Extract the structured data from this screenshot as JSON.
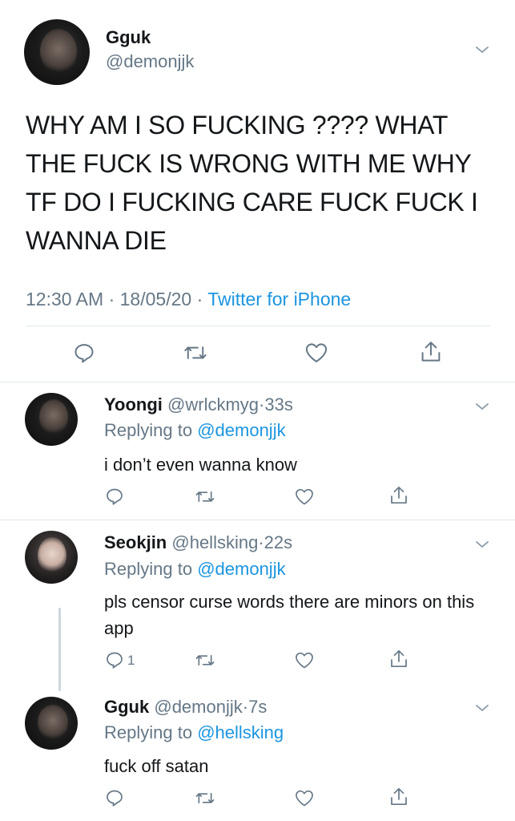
{
  "main_tweet": {
    "display_name": "Gguk",
    "handle": "@demonjjk",
    "text": "WHY AM I SO FUCKING ????  WHAT THE FUCK IS WRONG WITH ME WHY TF DO I FUCKING CARE FUCK FUCK I WANNA DIE",
    "time": "12:30 AM",
    "date": "18/05/20",
    "source": "Twitter for iPhone",
    "separator": "·"
  },
  "replies": [
    {
      "display_name": "Yoongi",
      "handle": "@wrlckmyg",
      "age": "33s",
      "replying_label": "Replying to",
      "replying_to": "@demonjjk",
      "text": "i don’t even wanna know",
      "reply_count": ""
    },
    {
      "display_name": "Seokjin",
      "handle": "@hellsking",
      "age": "22s",
      "replying_label": "Replying to",
      "replying_to": "@demonjjk",
      "text": "pls censor curse words there are minors on this app",
      "reply_count": "1"
    },
    {
      "display_name": "Gguk",
      "handle": "@demonjjk",
      "age": "7s",
      "replying_label": "Replying to",
      "replying_to": "@hellsking",
      "text": "fuck off satan",
      "reply_count": ""
    }
  ],
  "icons": {
    "reply": "reply-icon",
    "retweet": "retweet-icon",
    "like": "heart-icon",
    "share": "share-icon",
    "more": "chevron-down-icon"
  },
  "colors": {
    "link": "#1b95e0",
    "muted": "#657786",
    "text": "#14171a",
    "divider": "#e1e8ed"
  }
}
